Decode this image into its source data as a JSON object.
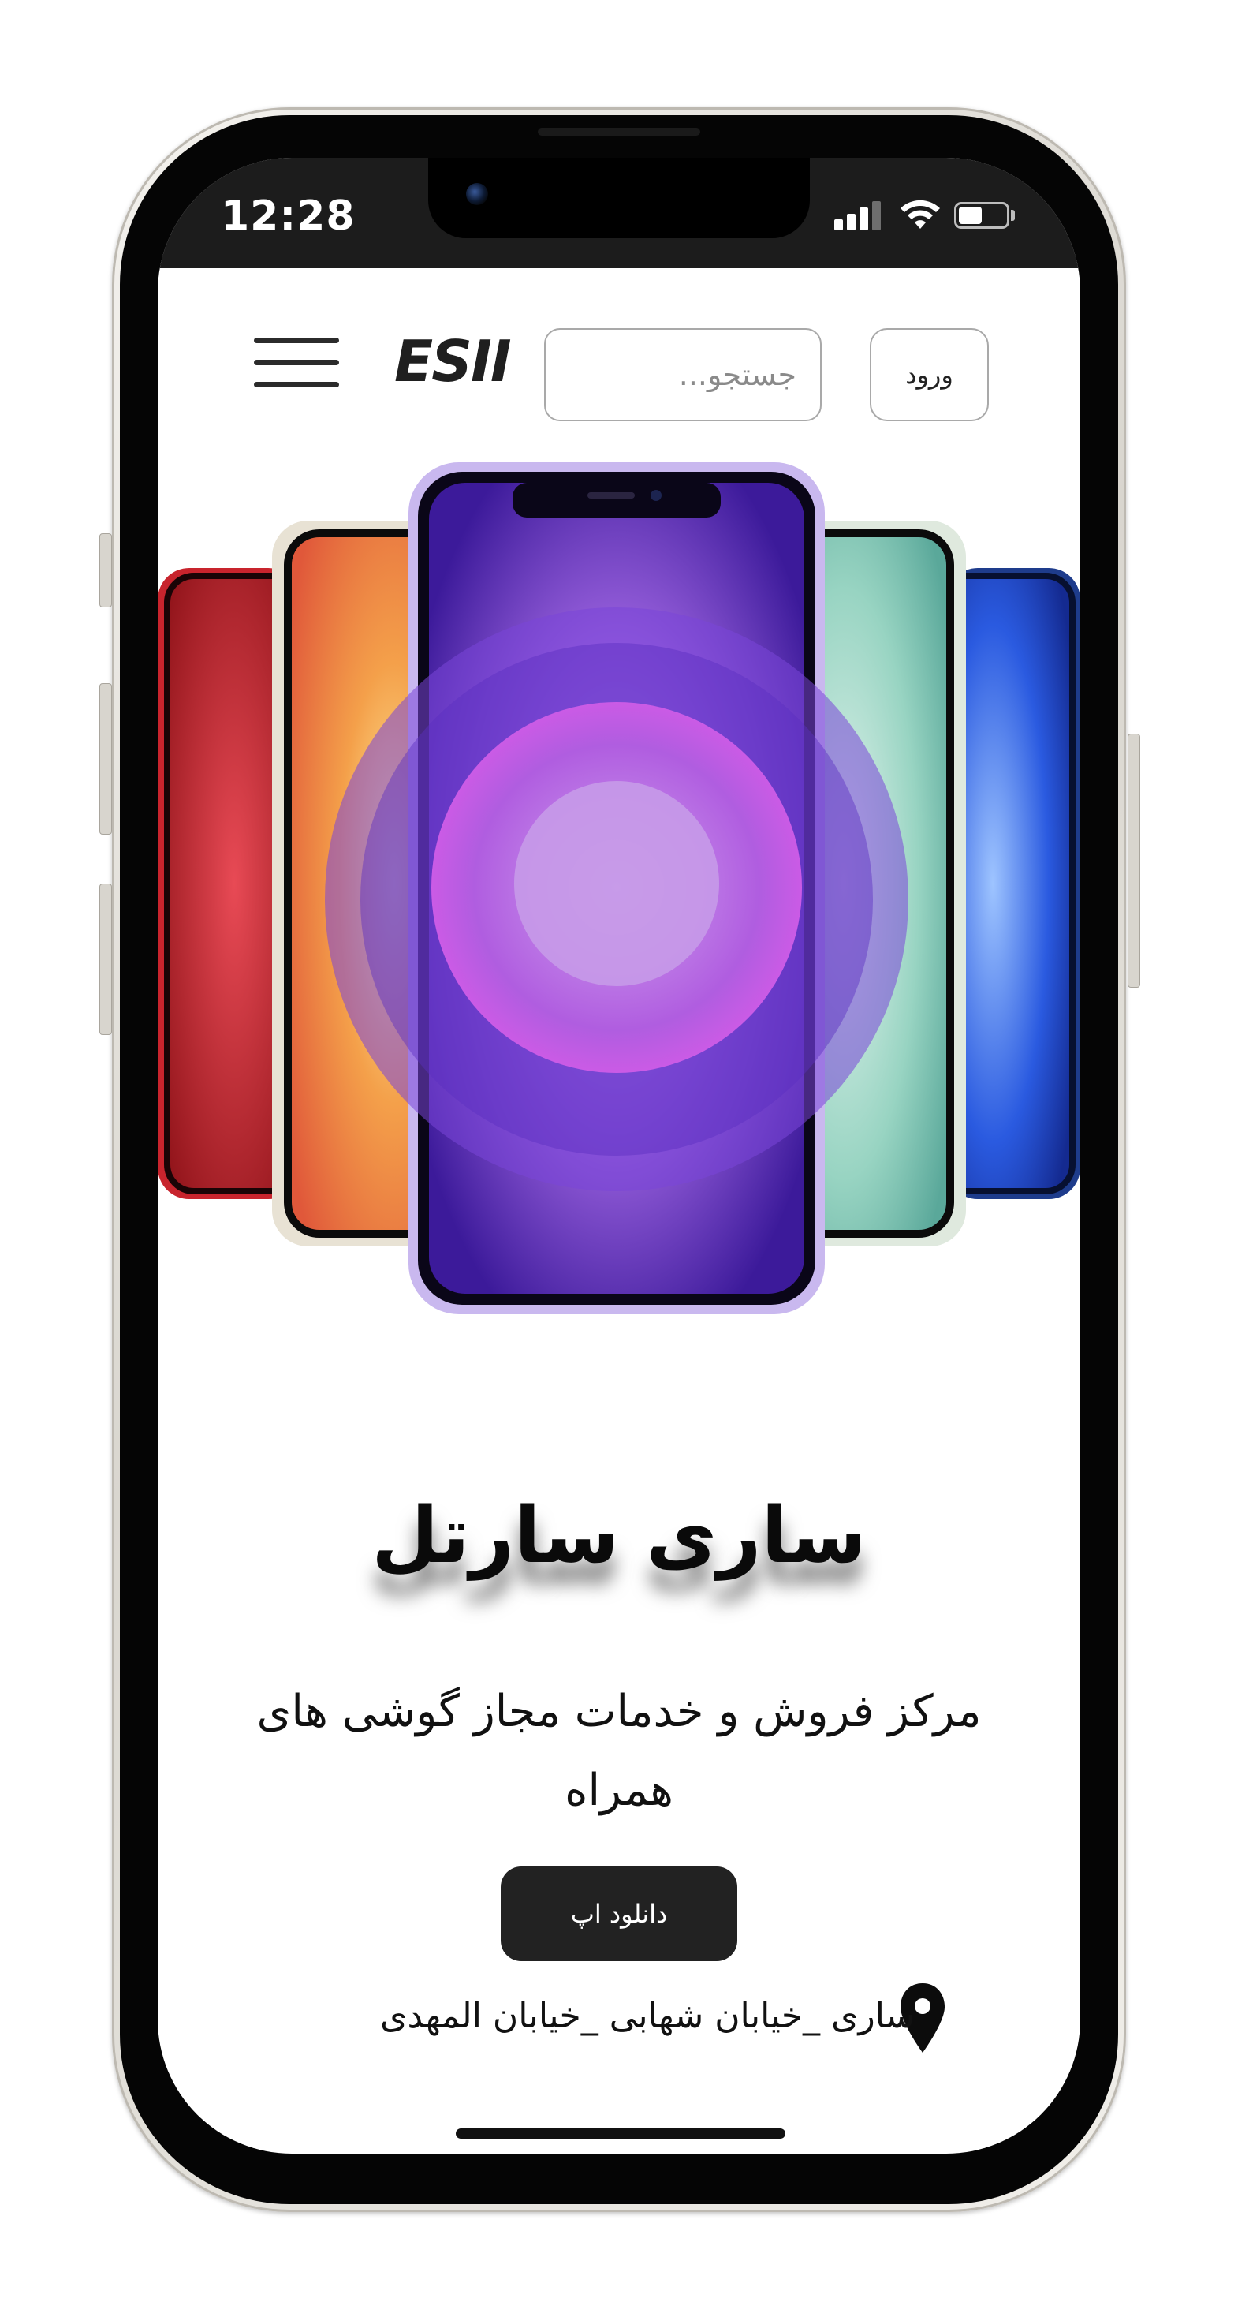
{
  "status_bar": {
    "time": "12:28",
    "signal_bars_active": 3,
    "signal_bars_total": 4,
    "battery_level": 0.5
  },
  "header": {
    "logo_text": "ESII",
    "search_placeholder": "جستجو...",
    "login_label": "ورود"
  },
  "hero": {
    "phone_colors": [
      "#c8242d",
      "#f0a040",
      "#7a52c8",
      "#8fd0b8",
      "#2048b8"
    ]
  },
  "main": {
    "title": "ساری سارتل",
    "subtitle": "مرکز فروش و خدمات مجاز گوشی های همراه",
    "download_label": "دانلود اپ",
    "address": "ساری _خیابان شهابی _خیابان المهدی"
  },
  "icons": {
    "menu": "hamburger-menu-icon",
    "location": "location-pin-icon",
    "wifi": "wifi-icon",
    "battery": "battery-icon",
    "signal": "cellular-signal-icon"
  }
}
